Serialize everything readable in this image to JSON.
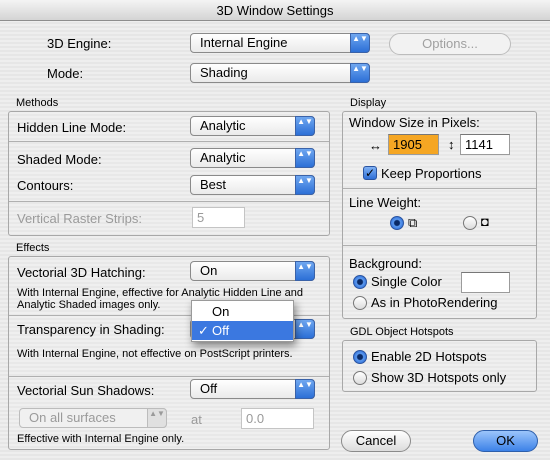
{
  "window": {
    "title": "3D Window Settings"
  },
  "top": {
    "engine_label": "3D Engine:",
    "engine_value": "Internal Engine",
    "options_label": "Options...",
    "mode_label": "Mode:",
    "mode_value": "Shading"
  },
  "methods": {
    "title": "Methods",
    "hidden_line_label": "Hidden Line Mode:",
    "hidden_line_value": "Analytic",
    "shaded_label": "Shaded Mode:",
    "shaded_value": "Analytic",
    "contours_label": "Contours:",
    "contours_value": "Best",
    "raster_label": "Vertical Raster Strips:",
    "raster_value": "5"
  },
  "effects": {
    "title": "Effects",
    "hatching_label": "Vectorial 3D Hatching:",
    "hatching_value": "On",
    "hatching_note": "With Internal Engine, effective for Analytic Hidden Line and Analytic Shaded images only.",
    "transparency_label": "Transparency in Shading:",
    "transparency_note": "With Internal Engine, not effective on PostScript printers.",
    "transparency_menu": {
      "items": [
        "On",
        "Off"
      ],
      "selected": "Off",
      "checkmark": "✓"
    },
    "sun_label": "Vectorial Sun Shadows:",
    "sun_value": "Off",
    "surfaces_value": "On all surfaces",
    "at_label": "at",
    "at_value": "0.0",
    "sun_note": "Effective with Internal Engine only."
  },
  "display": {
    "title": "Display",
    "window_size_label": "Window Size in Pixels:",
    "width_icon": "↔",
    "width_value": "1905",
    "height_icon": "↕",
    "height_value": "1141",
    "keep_proportions": "Keep Proportions",
    "line_weight_label": "Line Weight:",
    "background_label": "Background:",
    "single_color": "Single Color",
    "photorendering": "As in PhotoRendering"
  },
  "gdl": {
    "title": "GDL Object Hotspots",
    "enable_2d": "Enable 2D Hotspots",
    "show_3d": "Show 3D Hotspots only"
  },
  "buttons": {
    "cancel": "Cancel",
    "ok": "OK"
  },
  "icons": {
    "popup_arrows": "▲▼",
    "cube_thin": "⧉",
    "cube_thick": "◘"
  },
  "colors": {
    "accent": "#3b78e0",
    "highlight_field": "#f5a623"
  }
}
